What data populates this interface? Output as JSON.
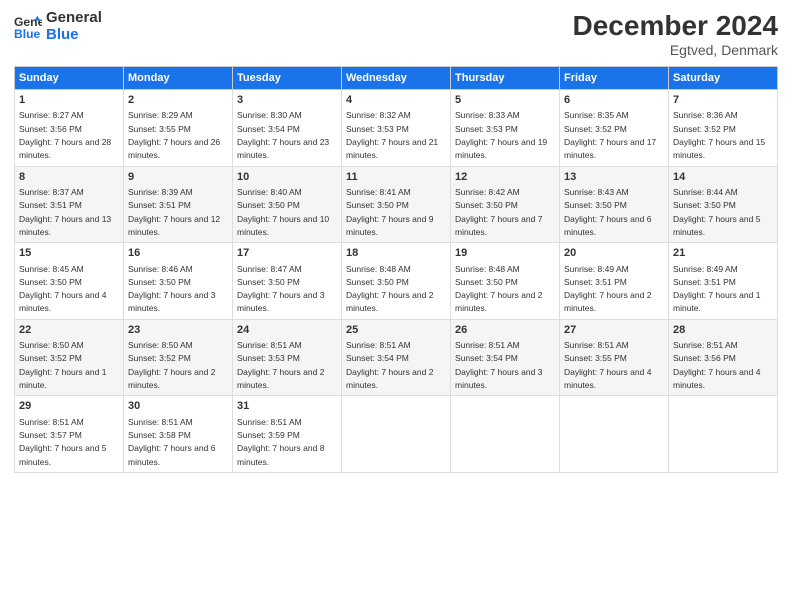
{
  "logo": {
    "line1": "General",
    "line2": "Blue"
  },
  "title": "December 2024",
  "location": "Egtved, Denmark",
  "days_of_week": [
    "Sunday",
    "Monday",
    "Tuesday",
    "Wednesday",
    "Thursday",
    "Friday",
    "Saturday"
  ],
  "weeks": [
    [
      {
        "day": "1",
        "sunrise": "8:27 AM",
        "sunset": "3:56 PM",
        "daylight": "7 hours and 28 minutes."
      },
      {
        "day": "2",
        "sunrise": "8:29 AM",
        "sunset": "3:55 PM",
        "daylight": "7 hours and 26 minutes."
      },
      {
        "day": "3",
        "sunrise": "8:30 AM",
        "sunset": "3:54 PM",
        "daylight": "7 hours and 23 minutes."
      },
      {
        "day": "4",
        "sunrise": "8:32 AM",
        "sunset": "3:53 PM",
        "daylight": "7 hours and 21 minutes."
      },
      {
        "day": "5",
        "sunrise": "8:33 AM",
        "sunset": "3:53 PM",
        "daylight": "7 hours and 19 minutes."
      },
      {
        "day": "6",
        "sunrise": "8:35 AM",
        "sunset": "3:52 PM",
        "daylight": "7 hours and 17 minutes."
      },
      {
        "day": "7",
        "sunrise": "8:36 AM",
        "sunset": "3:52 PM",
        "daylight": "7 hours and 15 minutes."
      }
    ],
    [
      {
        "day": "8",
        "sunrise": "8:37 AM",
        "sunset": "3:51 PM",
        "daylight": "7 hours and 13 minutes."
      },
      {
        "day": "9",
        "sunrise": "8:39 AM",
        "sunset": "3:51 PM",
        "daylight": "7 hours and 12 minutes."
      },
      {
        "day": "10",
        "sunrise": "8:40 AM",
        "sunset": "3:50 PM",
        "daylight": "7 hours and 10 minutes."
      },
      {
        "day": "11",
        "sunrise": "8:41 AM",
        "sunset": "3:50 PM",
        "daylight": "7 hours and 9 minutes."
      },
      {
        "day": "12",
        "sunrise": "8:42 AM",
        "sunset": "3:50 PM",
        "daylight": "7 hours and 7 minutes."
      },
      {
        "day": "13",
        "sunrise": "8:43 AM",
        "sunset": "3:50 PM",
        "daylight": "7 hours and 6 minutes."
      },
      {
        "day": "14",
        "sunrise": "8:44 AM",
        "sunset": "3:50 PM",
        "daylight": "7 hours and 5 minutes."
      }
    ],
    [
      {
        "day": "15",
        "sunrise": "8:45 AM",
        "sunset": "3:50 PM",
        "daylight": "7 hours and 4 minutes."
      },
      {
        "day": "16",
        "sunrise": "8:46 AM",
        "sunset": "3:50 PM",
        "daylight": "7 hours and 3 minutes."
      },
      {
        "day": "17",
        "sunrise": "8:47 AM",
        "sunset": "3:50 PM",
        "daylight": "7 hours and 3 minutes."
      },
      {
        "day": "18",
        "sunrise": "8:48 AM",
        "sunset": "3:50 PM",
        "daylight": "7 hours and 2 minutes."
      },
      {
        "day": "19",
        "sunrise": "8:48 AM",
        "sunset": "3:50 PM",
        "daylight": "7 hours and 2 minutes."
      },
      {
        "day": "20",
        "sunrise": "8:49 AM",
        "sunset": "3:51 PM",
        "daylight": "7 hours and 2 minutes."
      },
      {
        "day": "21",
        "sunrise": "8:49 AM",
        "sunset": "3:51 PM",
        "daylight": "7 hours and 1 minute."
      }
    ],
    [
      {
        "day": "22",
        "sunrise": "8:50 AM",
        "sunset": "3:52 PM",
        "daylight": "7 hours and 1 minute."
      },
      {
        "day": "23",
        "sunrise": "8:50 AM",
        "sunset": "3:52 PM",
        "daylight": "7 hours and 2 minutes."
      },
      {
        "day": "24",
        "sunrise": "8:51 AM",
        "sunset": "3:53 PM",
        "daylight": "7 hours and 2 minutes."
      },
      {
        "day": "25",
        "sunrise": "8:51 AM",
        "sunset": "3:54 PM",
        "daylight": "7 hours and 2 minutes."
      },
      {
        "day": "26",
        "sunrise": "8:51 AM",
        "sunset": "3:54 PM",
        "daylight": "7 hours and 3 minutes."
      },
      {
        "day": "27",
        "sunrise": "8:51 AM",
        "sunset": "3:55 PM",
        "daylight": "7 hours and 4 minutes."
      },
      {
        "day": "28",
        "sunrise": "8:51 AM",
        "sunset": "3:56 PM",
        "daylight": "7 hours and 4 minutes."
      }
    ],
    [
      {
        "day": "29",
        "sunrise": "8:51 AM",
        "sunset": "3:57 PM",
        "daylight": "7 hours and 5 minutes."
      },
      {
        "day": "30",
        "sunrise": "8:51 AM",
        "sunset": "3:58 PM",
        "daylight": "7 hours and 6 minutes."
      },
      {
        "day": "31",
        "sunrise": "8:51 AM",
        "sunset": "3:59 PM",
        "daylight": "7 hours and 8 minutes."
      },
      null,
      null,
      null,
      null
    ]
  ]
}
